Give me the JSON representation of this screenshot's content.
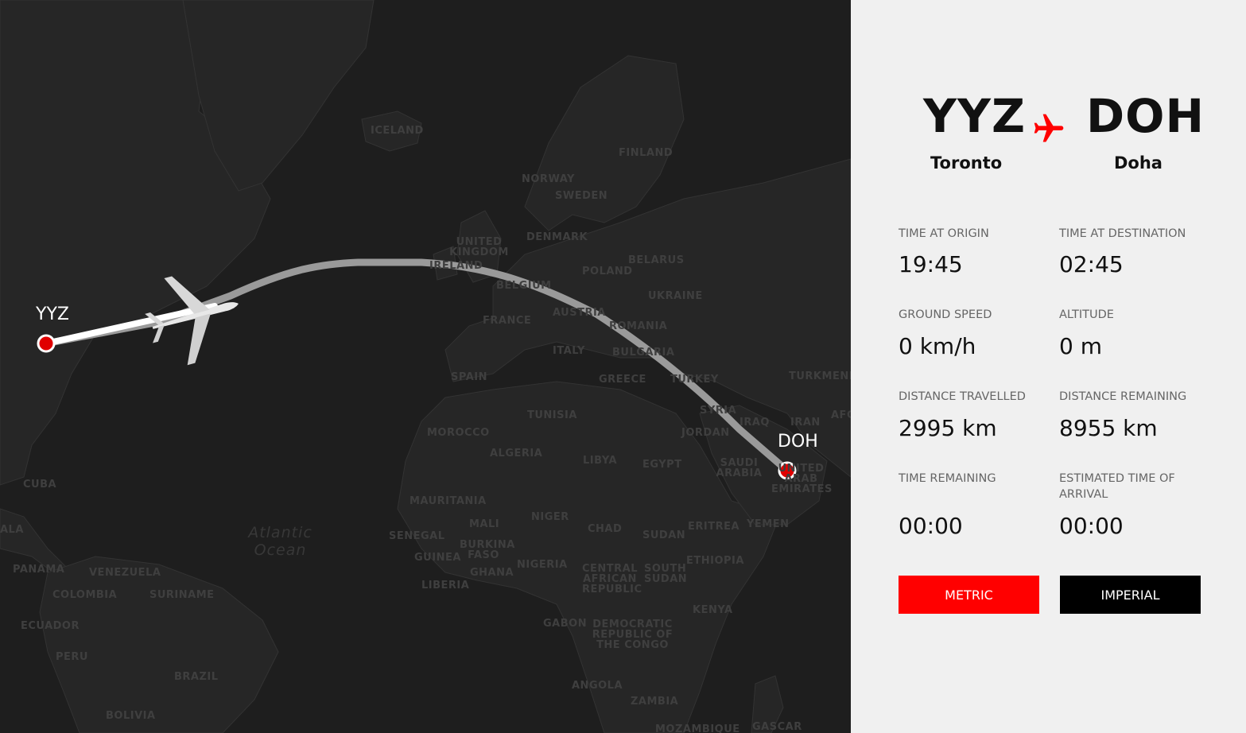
{
  "colors": {
    "accent": "#ff0000",
    "map_background": "#1e1e1e",
    "land": "#262626",
    "route": "#9a9a9a",
    "marker": "#e00000",
    "imperial_button": "#000000"
  },
  "map": {
    "labels": {
      "iceland": "ICELAND",
      "finland": "FINLAND",
      "norway": "NORWAY",
      "sweden": "SWEDEN",
      "united_kingdom": "UNITED KINGDOM",
      "denmark": "DENMARK",
      "ireland": "IRELAND",
      "belarus": "BELARUS",
      "poland": "POLAND",
      "belgium": "BELGIUM",
      "ukraine": "UKRAINE",
      "france": "FRANCE",
      "austria": "AUSTRIA",
      "romania": "ROMANIA",
      "italy": "ITALY",
      "bulgaria": "BULGARIA",
      "spain": "SPAIN",
      "greece": "GREECE",
      "turkey": "TURKEY",
      "turkmenistan": "TURKMENIS",
      "tunisia": "TUNISIA",
      "syria": "SYRIA",
      "iraq": "IRAQ",
      "iran": "IRAN",
      "afg": "AFG",
      "morocco": "MOROCCO",
      "jordan": "JORDAN",
      "algeria": "ALGERIA",
      "libya": "LIBYA",
      "egypt": "EGYPT",
      "saudi_arabia": "SAUDI ARABIA",
      "uae": "UNITED ARAB EMIRATES",
      "cuba": "CUBA",
      "mauritania": "MAURITANIA",
      "mali": "MALI",
      "niger": "NIGER",
      "chad": "CHAD",
      "sudan": "SUDAN",
      "eritrea": "ERITREA",
      "yemen": "YEMEN",
      "senegal": "SENEGAL",
      "burkina_faso": "BURKINA FASO",
      "guinea": "GUINEA",
      "ghana": "GHANA",
      "nigeria": "NIGERIA",
      "central_african_republic": "CENTRAL AFRICAN REPUBLIC",
      "south_sudan": "SOUTH SUDAN",
      "ethiopia": "ETHIOPIA",
      "liberia": "LIBERIA",
      "panama": "PANAMA",
      "venezuela": "VENEZUELA",
      "colombia": "COLOMBIA",
      "suriname": "SURINAME",
      "ecuador": "ECUADOR",
      "kenya": "KENYA",
      "gabon": "GABON",
      "drc": "DEMOCRATIC REPUBLIC OF THE CONGO",
      "peru": "PERU",
      "brazil": "BRAZIL",
      "angola": "ANGOLA",
      "zambia": "ZAMBIA",
      "bolivia": "BOLIVIA",
      "mozambique": "MOZAMBIQUE",
      "madagascar": "GASCAR",
      "ala": "ALA"
    },
    "ocean": "Atlantic Ocean",
    "origin_code": "YYZ",
    "destination_code": "DOH"
  },
  "panel": {
    "origin": {
      "code": "YYZ",
      "city": "Toronto"
    },
    "destination": {
      "code": "DOH",
      "city": "Doha"
    },
    "stats": {
      "time_at_origin": {
        "label": "TIME AT ORIGIN",
        "value": "19:45"
      },
      "time_at_destination": {
        "label": "TIME AT DESTINATION",
        "value": "02:45"
      },
      "ground_speed": {
        "label": "GROUND SPEED",
        "value": "0 km/h"
      },
      "altitude": {
        "label": "ALTITUDE",
        "value": "0 m"
      },
      "distance_travelled": {
        "label": "DISTANCE TRAVELLED",
        "value": "2995 km"
      },
      "distance_remaining": {
        "label": "DISTANCE REMAINING",
        "value": "8955 km"
      },
      "time_remaining": {
        "label": "TIME REMAINING",
        "value": "00:00"
      },
      "eta": {
        "label": "ESTIMATED TIME OF ARRIVAL",
        "value": "00:00"
      }
    },
    "buttons": {
      "metric": "METRIC",
      "imperial": "IMPERIAL"
    }
  }
}
